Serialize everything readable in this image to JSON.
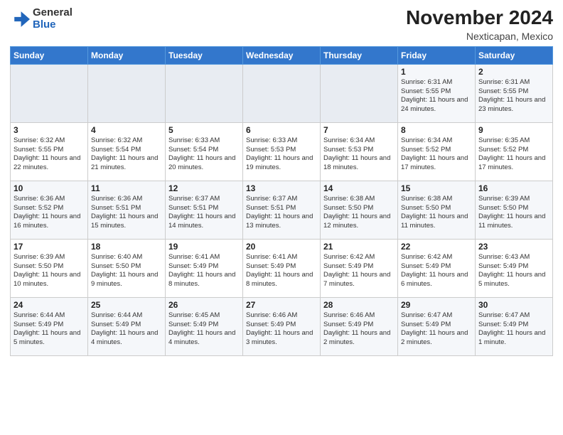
{
  "header": {
    "month_title": "November 2024",
    "location": "Nexticapan, Mexico",
    "logo_general": "General",
    "logo_blue": "Blue"
  },
  "days_of_week": [
    "Sunday",
    "Monday",
    "Tuesday",
    "Wednesday",
    "Thursday",
    "Friday",
    "Saturday"
  ],
  "weeks": [
    {
      "days": [
        {
          "num": "",
          "empty": true
        },
        {
          "num": "",
          "empty": true
        },
        {
          "num": "",
          "empty": true
        },
        {
          "num": "",
          "empty": true
        },
        {
          "num": "",
          "empty": true
        },
        {
          "num": "1",
          "sunrise": "6:31 AM",
          "sunset": "5:55 PM",
          "daylight": "11 hours and 24 minutes."
        },
        {
          "num": "2",
          "sunrise": "6:31 AM",
          "sunset": "5:55 PM",
          "daylight": "11 hours and 23 minutes."
        }
      ]
    },
    {
      "days": [
        {
          "num": "3",
          "sunrise": "6:32 AM",
          "sunset": "5:55 PM",
          "daylight": "11 hours and 22 minutes."
        },
        {
          "num": "4",
          "sunrise": "6:32 AM",
          "sunset": "5:54 PM",
          "daylight": "11 hours and 21 minutes."
        },
        {
          "num": "5",
          "sunrise": "6:33 AM",
          "sunset": "5:54 PM",
          "daylight": "11 hours and 20 minutes."
        },
        {
          "num": "6",
          "sunrise": "6:33 AM",
          "sunset": "5:53 PM",
          "daylight": "11 hours and 19 minutes."
        },
        {
          "num": "7",
          "sunrise": "6:34 AM",
          "sunset": "5:53 PM",
          "daylight": "11 hours and 18 minutes."
        },
        {
          "num": "8",
          "sunrise": "6:34 AM",
          "sunset": "5:52 PM",
          "daylight": "11 hours and 17 minutes."
        },
        {
          "num": "9",
          "sunrise": "6:35 AM",
          "sunset": "5:52 PM",
          "daylight": "11 hours and 17 minutes."
        }
      ]
    },
    {
      "days": [
        {
          "num": "10",
          "sunrise": "6:36 AM",
          "sunset": "5:52 PM",
          "daylight": "11 hours and 16 minutes."
        },
        {
          "num": "11",
          "sunrise": "6:36 AM",
          "sunset": "5:51 PM",
          "daylight": "11 hours and 15 minutes."
        },
        {
          "num": "12",
          "sunrise": "6:37 AM",
          "sunset": "5:51 PM",
          "daylight": "11 hours and 14 minutes."
        },
        {
          "num": "13",
          "sunrise": "6:37 AM",
          "sunset": "5:51 PM",
          "daylight": "11 hours and 13 minutes."
        },
        {
          "num": "14",
          "sunrise": "6:38 AM",
          "sunset": "5:50 PM",
          "daylight": "11 hours and 12 minutes."
        },
        {
          "num": "15",
          "sunrise": "6:38 AM",
          "sunset": "5:50 PM",
          "daylight": "11 hours and 11 minutes."
        },
        {
          "num": "16",
          "sunrise": "6:39 AM",
          "sunset": "5:50 PM",
          "daylight": "11 hours and 11 minutes."
        }
      ]
    },
    {
      "days": [
        {
          "num": "17",
          "sunrise": "6:39 AM",
          "sunset": "5:50 PM",
          "daylight": "11 hours and 10 minutes."
        },
        {
          "num": "18",
          "sunrise": "6:40 AM",
          "sunset": "5:50 PM",
          "daylight": "11 hours and 9 minutes."
        },
        {
          "num": "19",
          "sunrise": "6:41 AM",
          "sunset": "5:49 PM",
          "daylight": "11 hours and 8 minutes."
        },
        {
          "num": "20",
          "sunrise": "6:41 AM",
          "sunset": "5:49 PM",
          "daylight": "11 hours and 8 minutes."
        },
        {
          "num": "21",
          "sunrise": "6:42 AM",
          "sunset": "5:49 PM",
          "daylight": "11 hours and 7 minutes."
        },
        {
          "num": "22",
          "sunrise": "6:42 AM",
          "sunset": "5:49 PM",
          "daylight": "11 hours and 6 minutes."
        },
        {
          "num": "23",
          "sunrise": "6:43 AM",
          "sunset": "5:49 PM",
          "daylight": "11 hours and 5 minutes."
        }
      ]
    },
    {
      "days": [
        {
          "num": "24",
          "sunrise": "6:44 AM",
          "sunset": "5:49 PM",
          "daylight": "11 hours and 5 minutes."
        },
        {
          "num": "25",
          "sunrise": "6:44 AM",
          "sunset": "5:49 PM",
          "daylight": "11 hours and 4 minutes."
        },
        {
          "num": "26",
          "sunrise": "6:45 AM",
          "sunset": "5:49 PM",
          "daylight": "11 hours and 4 minutes."
        },
        {
          "num": "27",
          "sunrise": "6:46 AM",
          "sunset": "5:49 PM",
          "daylight": "11 hours and 3 minutes."
        },
        {
          "num": "28",
          "sunrise": "6:46 AM",
          "sunset": "5:49 PM",
          "daylight": "11 hours and 2 minutes."
        },
        {
          "num": "29",
          "sunrise": "6:47 AM",
          "sunset": "5:49 PM",
          "daylight": "11 hours and 2 minutes."
        },
        {
          "num": "30",
          "sunrise": "6:47 AM",
          "sunset": "5:49 PM",
          "daylight": "11 hours and 1 minute."
        }
      ]
    }
  ]
}
